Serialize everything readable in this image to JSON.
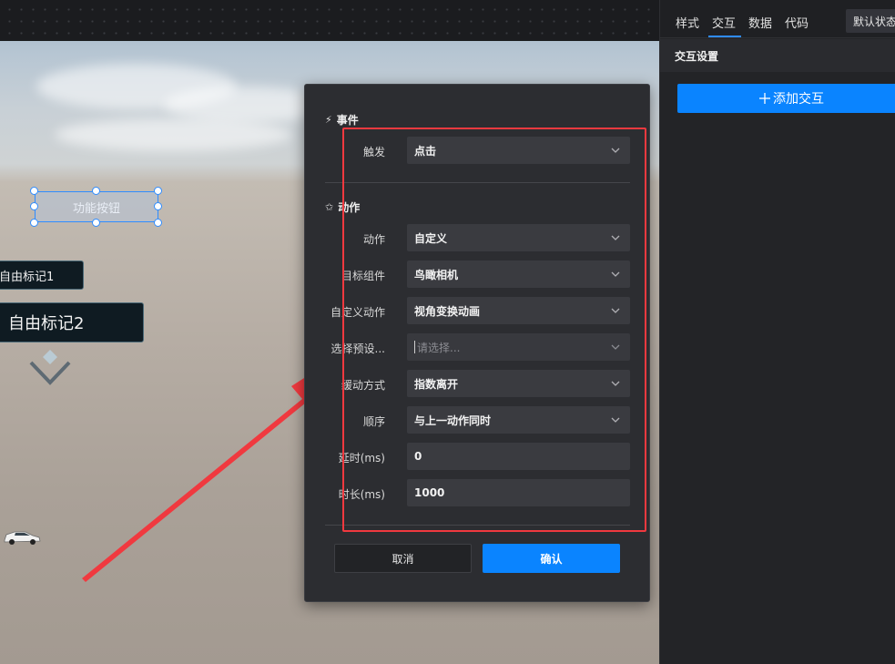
{
  "scene": {
    "function_button_label": "功能按钮",
    "marker1_label": "自由标记1",
    "marker2_label": "自由标记2"
  },
  "dialog": {
    "event_section_title": "事件",
    "trigger_label": "触发",
    "trigger_value": "点击",
    "action_section_title": "动作",
    "fields": {
      "action": {
        "label": "动作",
        "value": "自定义"
      },
      "target": {
        "label": "目标组件",
        "value": "鸟瞰相机"
      },
      "custom_action": {
        "label": "自定义动作",
        "value": "视角变换动画"
      },
      "preset": {
        "label": "选择预设...",
        "placeholder": "请选择..."
      },
      "easing": {
        "label": "缓动方式",
        "value": "指数离开"
      },
      "order": {
        "label": "顺序",
        "value": "与上一动作同时"
      },
      "delay": {
        "label": "延时(ms)",
        "value": "0"
      },
      "duration": {
        "label": "时长(ms)",
        "value": "1000"
      }
    },
    "cancel_label": "取消",
    "confirm_label": "确认"
  },
  "right_panel": {
    "tabs": [
      "样式",
      "交互",
      "数据",
      "代码"
    ],
    "active_tab": "交互",
    "state_select": "默认状态",
    "header": "交互设置",
    "add_interaction_label": "添加交互"
  },
  "colors": {
    "accent": "#0a84ff",
    "selection": "#2f8cff",
    "annotation_red": "#f0393f"
  },
  "icons": {
    "event": "lightning-icon",
    "action": "star-icon",
    "select_arrow": "chevron-down-icon",
    "add": "plus-icon"
  }
}
